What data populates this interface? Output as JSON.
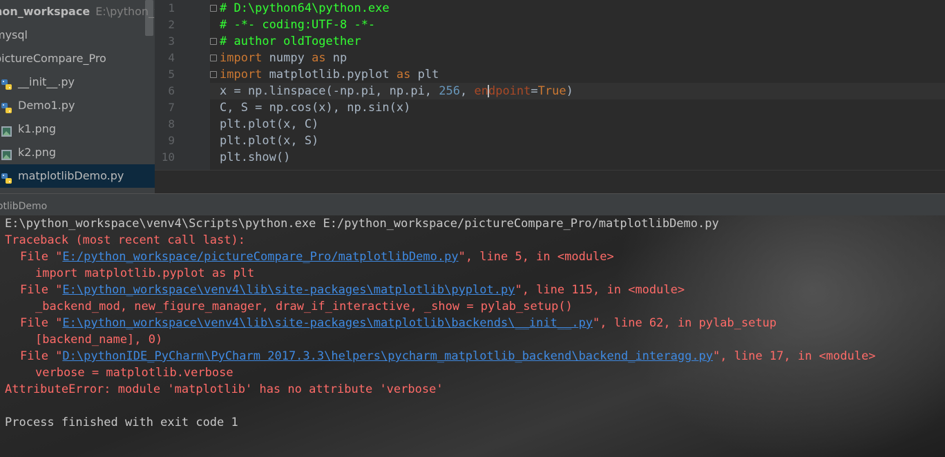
{
  "project_tree": {
    "root_name": "hon_workspace",
    "root_path": "E:\\python_w",
    "items": [
      {
        "label": "mysql",
        "icon": "folder-icon"
      },
      {
        "label": "pictureCompare_Pro",
        "icon": "folder-icon"
      },
      {
        "label": "__init__.py",
        "icon": "python-file-icon"
      },
      {
        "label": "Demo1.py",
        "icon": "python-file-icon"
      },
      {
        "label": "k1.png",
        "icon": "image-file-icon"
      },
      {
        "label": "k2.png",
        "icon": "image-file-icon"
      },
      {
        "label": "matplotlibDemo.py",
        "icon": "python-file-icon",
        "selected": true
      }
    ]
  },
  "editor": {
    "line_numbers": [
      "1",
      "2",
      "3",
      "4",
      "5",
      "6",
      "7",
      "8",
      "9",
      "10"
    ],
    "lines": [
      {
        "comment": "# D:\\python64\\python.exe"
      },
      {
        "comment": "# -*- coding:UTF-8 -*-"
      },
      {
        "comment": "# author oldTogether"
      },
      {
        "kw1": "import",
        "mid": " numpy ",
        "kw2": "as",
        "rest": " np"
      },
      {
        "kw1": "import",
        "mid": " matplotlib.pyplot ",
        "kw2": "as",
        "rest": " plt"
      },
      {
        "p1": "x = np.linspace(-np.pi, np.pi, ",
        "num": "256",
        "p2": ", ",
        "param_a": "en",
        "param_b": "dpoint",
        "p3": "=",
        "kw": "True",
        "p4": ")"
      },
      {
        "text": "C, S = np.cos(x), np.sin(x)"
      },
      {
        "text": "plt.plot(x, C)"
      },
      {
        "text": "plt.plot(x, S)"
      },
      {
        "text": "plt.show()"
      }
    ]
  },
  "run_panel": {
    "title": "lotlibDemo"
  },
  "console": {
    "command": "E:\\python_workspace\\venv4\\Scripts\\python.exe E:/python_workspace/pictureCompare_Pro/matplotlibDemo.py",
    "traceback_header": "Traceback (most recent call last):",
    "frames": [
      {
        "prefix": "File \"",
        "link": "E:/python_workspace/pictureCompare_Pro/matplotlibDemo.py",
        "suffix": "\", line 5, in <module>",
        "code": "import matplotlib.pyplot as plt"
      },
      {
        "prefix": "File \"",
        "link": "E:\\python_workspace\\venv4\\lib\\site-packages\\matplotlib\\pyplot.py",
        "suffix": "\", line 115, in <module>",
        "code": "_backend_mod, new_figure_manager, draw_if_interactive, _show = pylab_setup()"
      },
      {
        "prefix": "File \"",
        "link": "E:\\python_workspace\\venv4\\lib\\site-packages\\matplotlib\\backends\\__init__.py",
        "suffix": "\", line 62, in pylab_setup",
        "code": "[backend_name], 0)"
      },
      {
        "prefix": "File \"",
        "link": "D:\\pythonIDE_PyCharm\\PyCharm 2017.3.3\\helpers\\pycharm_matplotlib_backend\\backend_interagg.py",
        "suffix": "\", line 17, in <module>",
        "code": "verbose = matplotlib.verbose"
      }
    ],
    "error": "AttributeError: module 'matplotlib' has no attribute 'verbose'",
    "exit_message": "Process finished with exit code 1"
  },
  "colors": {
    "comment": "#33ff33",
    "keyword": "#cc7832",
    "number": "#6897bb",
    "error_text": "#ff6b68",
    "link": "#3f8ae2",
    "selection": "#0d293e"
  }
}
